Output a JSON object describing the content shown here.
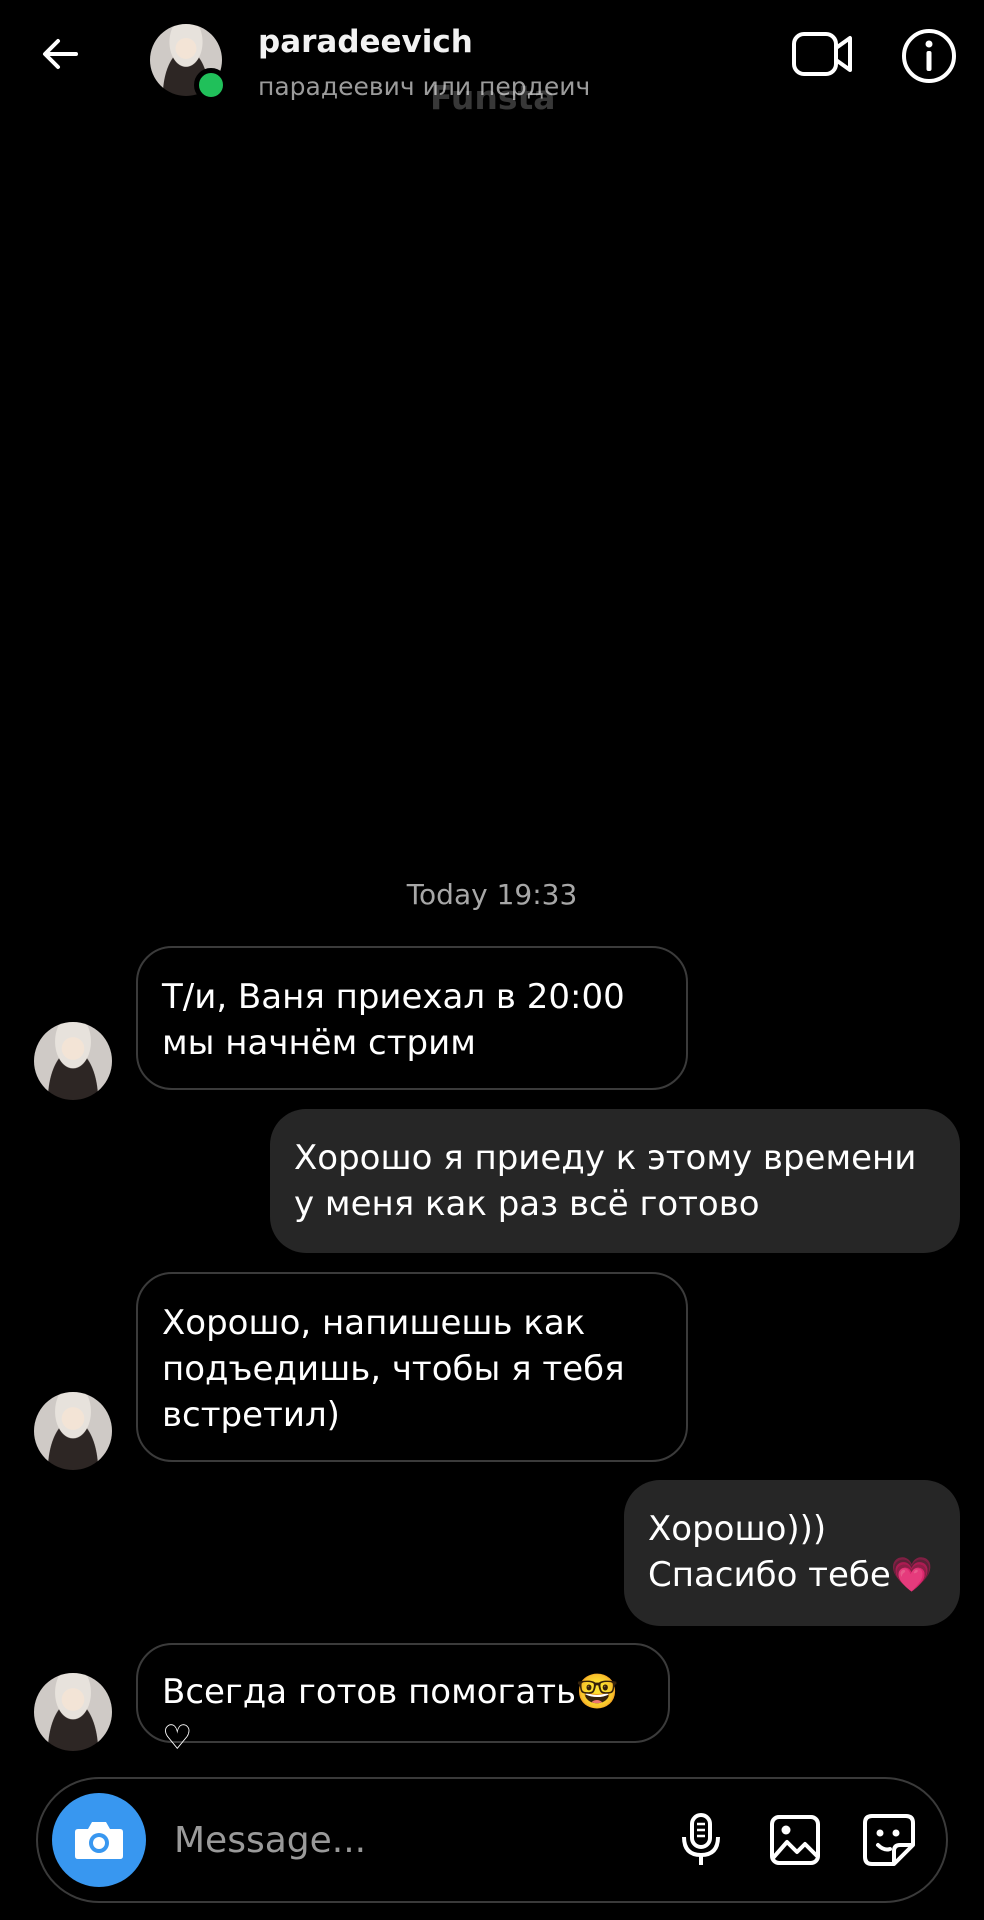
{
  "header": {
    "username": "paradeevich",
    "subtitle": "парадеевич или пердеич",
    "watermark": "Funsta",
    "online_color": "#20c05a",
    "icons": [
      "back-arrow-icon",
      "video-call-icon",
      "info-icon"
    ]
  },
  "chat": {
    "timestamp": "Today 19:33",
    "messages": [
      {
        "direction": "incoming",
        "text": "Т/и, Ваня приехал в 20:00\nмы начнём стрим"
      },
      {
        "direction": "outgoing",
        "text": "Хорошо я приеду к этому времени\nу меня как раз всё готово"
      },
      {
        "direction": "incoming",
        "text": "Хорошо, напишешь как\nподъедишь, чтобы я тебя\nвстретил)"
      },
      {
        "direction": "outgoing",
        "text": "Хорошо)))\nСпасибо тебе💗"
      },
      {
        "direction": "incoming",
        "text": "Всегда готов помогать🤓♡"
      }
    ]
  },
  "composer": {
    "placeholder": "Message...",
    "accent_color": "#3897f0",
    "icons": [
      "camera-icon",
      "microphone-icon",
      "gallery-icon",
      "sticker-icon"
    ]
  }
}
